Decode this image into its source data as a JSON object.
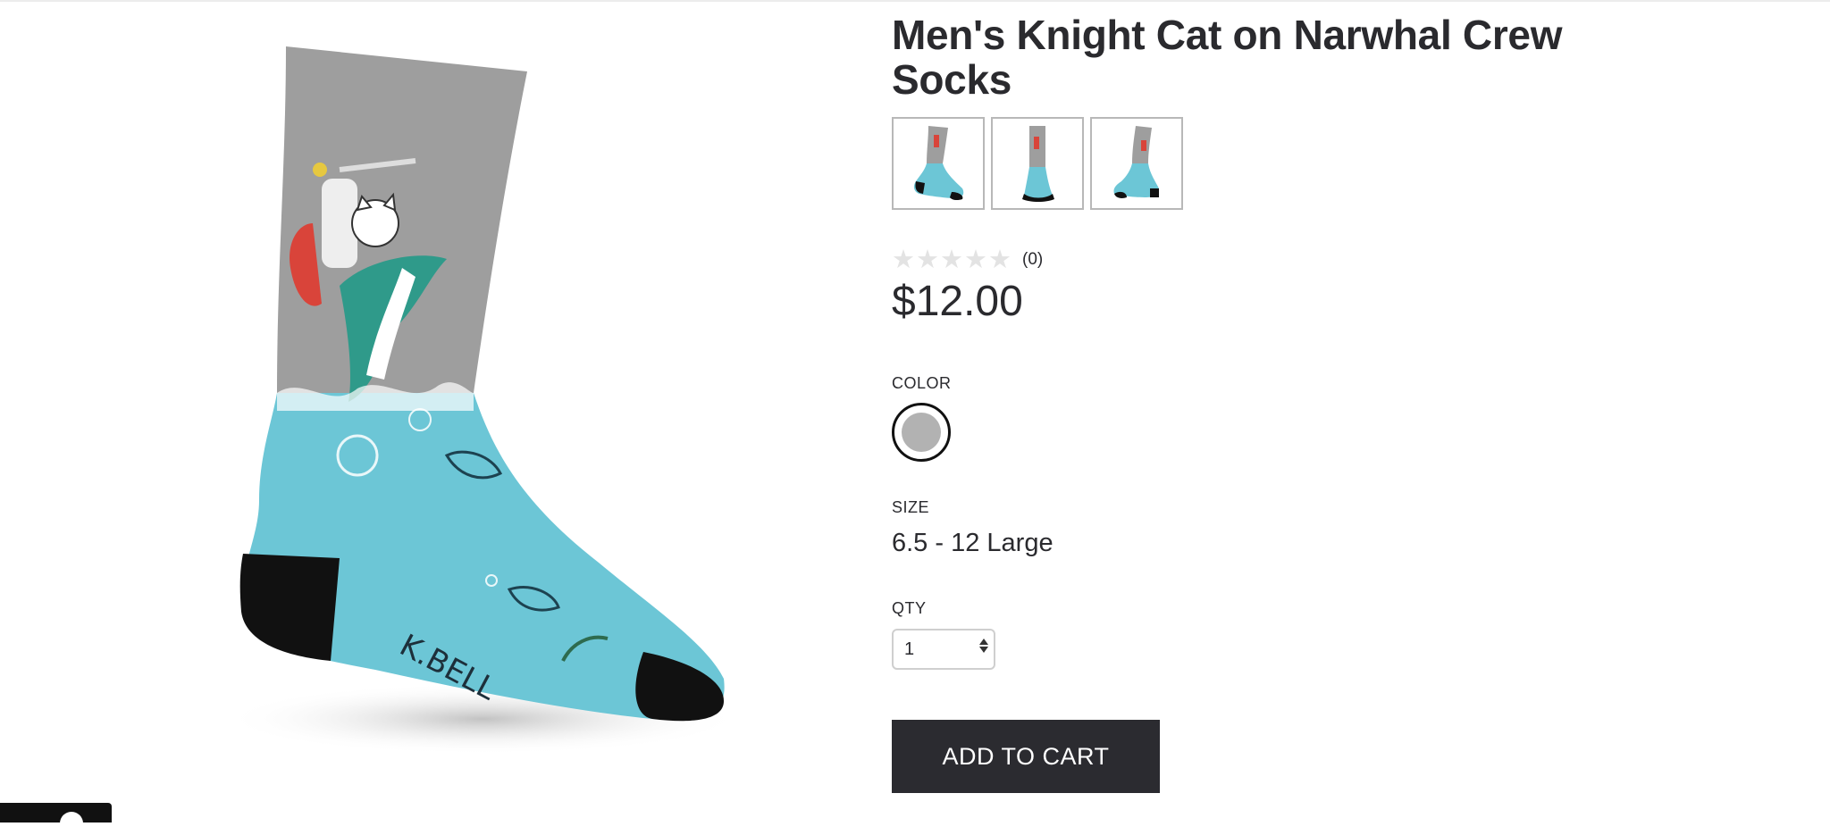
{
  "product": {
    "title": "Men's Knight Cat on Narwhal Crew Socks",
    "price": "$12.00",
    "rating": {
      "stars": 0,
      "max": 5,
      "count_text": "(0)"
    },
    "main_image_alt": "Men's Knight Cat on Narwhal Crew Socks",
    "sock_brand_print": "K.BELL"
  },
  "thumbnails": [
    {
      "name": "thumbnail-side-view"
    },
    {
      "name": "thumbnail-front-view"
    },
    {
      "name": "thumbnail-back-view"
    }
  ],
  "options": {
    "color_label": "COLOR",
    "selected_color_hex": "#b2b2b2",
    "size_label": "SIZE",
    "size_value": "6.5 - 12 Large",
    "qty_label": "QTY",
    "qty_value": "1"
  },
  "cart": {
    "add_label": "ADD TO CART"
  },
  "colors": {
    "sock_gray": "#9e9e9e",
    "sock_teal": "#6cc6d6",
    "sock_black": "#111111",
    "button_bg": "#2b2b30",
    "text": "#2a2a2e"
  },
  "icons": {
    "star": "star-icon",
    "qty_arrows": "updown-arrows-icon"
  }
}
